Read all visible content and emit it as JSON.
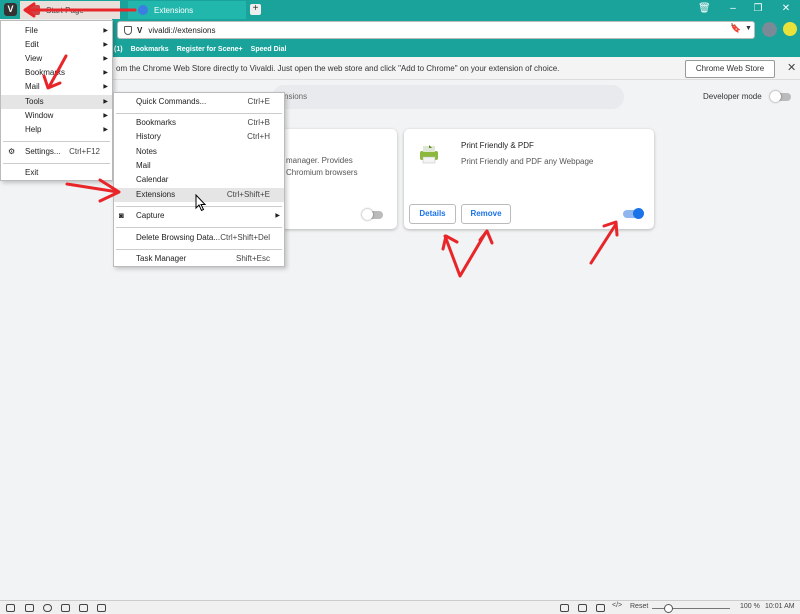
{
  "tabs": [
    {
      "label": "Start Page"
    },
    {
      "label": "Extensions"
    }
  ],
  "address": {
    "url": "vivaldi://extensions"
  },
  "bookmarks_bar": {
    "items": [
      "(1)",
      "Bookmarks",
      "Register for Scene+",
      "Speed Dial"
    ]
  },
  "infobar": {
    "text": "om the Chrome Web Store directly to Vivaldi. Just open the web store and click \"Add to Chrome\" on your extension of choice.",
    "button": "Chrome Web Store"
  },
  "search": {
    "placeholder": "nsions"
  },
  "developer_mode": {
    "label": "Developer mode",
    "enabled": false
  },
  "cards": [
    {
      "desc_line1": "manager. Provides",
      "desc_line2": "Chromium browsers",
      "enabled": false
    },
    {
      "title": "Print Friendly & PDF",
      "desc": "Print Friendly and PDF any Webpage",
      "details": "Details",
      "remove": "Remove",
      "enabled": true
    }
  ],
  "main_menu": {
    "items": [
      {
        "label": "File",
        "submenu": true
      },
      {
        "label": "Edit",
        "submenu": true
      },
      {
        "label": "View",
        "submenu": true
      },
      {
        "label": "Bookmarks",
        "submenu": true
      },
      {
        "label": "Mail",
        "submenu": true
      },
      {
        "label": "Tools",
        "submenu": true,
        "highlighted": true
      },
      {
        "label": "Window",
        "submenu": true
      },
      {
        "label": "Help",
        "submenu": true
      },
      {
        "label": "Settings...",
        "shortcut": "Ctrl+F12"
      },
      {
        "label": "Exit"
      }
    ]
  },
  "tools_menu": {
    "items": [
      {
        "label": "Quick Commands...",
        "shortcut": "Ctrl+E"
      },
      {
        "label": "Bookmarks",
        "shortcut": "Ctrl+B"
      },
      {
        "label": "History",
        "shortcut": "Ctrl+H"
      },
      {
        "label": "Notes"
      },
      {
        "label": "Mail"
      },
      {
        "label": "Calendar"
      },
      {
        "label": "Extensions",
        "shortcut": "Ctrl+Shift+E",
        "highlighted": true
      },
      {
        "label": "Capture",
        "submenu": true
      },
      {
        "label": "Delete Browsing Data...",
        "shortcut": "Ctrl+Shift+Del"
      },
      {
        "label": "Task Manager",
        "shortcut": "Shift+Esc"
      }
    ]
  },
  "statusbar": {
    "reset": "Reset",
    "zoom": "100 %",
    "time": "10:01 AM",
    "zoom_fraction": 0.15
  },
  "colors": {
    "accent": "#1aa39a",
    "toggle_on": "#1a73e8",
    "annotation": "#e8262a"
  }
}
